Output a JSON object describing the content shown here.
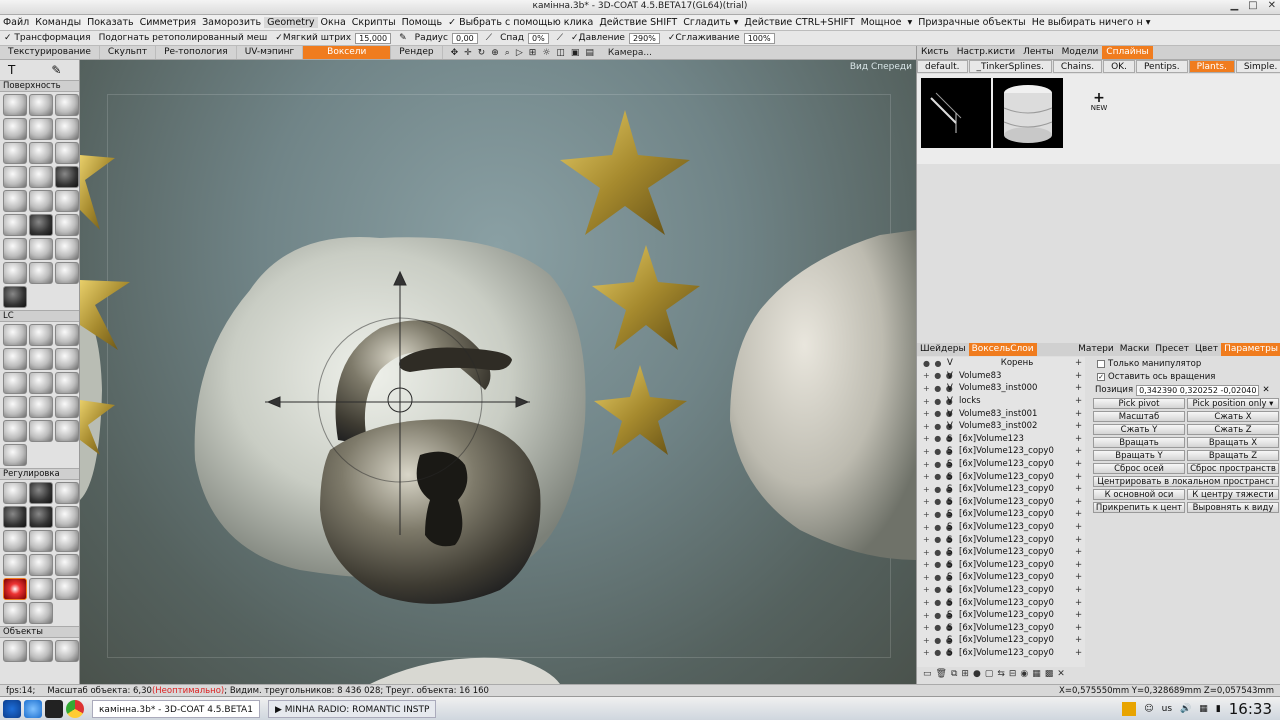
{
  "window": {
    "title": "камінна.3b* - 3D-COAT 4.5.BETA17(GL64)(trial)"
  },
  "menu": [
    "Файл",
    "Команды",
    "Показать",
    "Симметрия",
    "Заморозить",
    "Geometry",
    "Окна",
    "Скрипты",
    "Помощь",
    "✓ Выбрать с помощью клика",
    "Действие SHIFT",
    "Сгладить ▾",
    "Действие CTRL+SHIFT",
    "Мощное",
    "▾",
    "Призрачные объекты",
    "Не выбирать ничего н ▾"
  ],
  "options": {
    "transform": "✓ Трансформация",
    "retopo": "Подогнать ретополированный меш",
    "soft_stroke_label": "✓Мягкий штрих",
    "soft_stroke_value": "15,000",
    "radius_label": "Радиус",
    "radius_value": "0,00",
    "falloff_label": "Спад",
    "falloff_value": "0%",
    "pressure_label": "✓Давление",
    "pressure_value": "290%",
    "smoothing_label": "✓Сглаживание",
    "smoothing_value": "100%"
  },
  "rooms": {
    "tabs": [
      "Текстурирование",
      "Скульпт",
      "Ре-топология",
      "UV-мэпинг",
      "Воксели",
      "Рендер"
    ],
    "active": "Воксели",
    "camera": "Камера..."
  },
  "left": {
    "sections": [
      "Поверхность",
      "LC",
      "Регулировка",
      "Объекты"
    ]
  },
  "viewport": {
    "view_label": "Вид Спереди"
  },
  "right": {
    "tabs": [
      "Кисть",
      "Настр.кисти",
      "Ленты",
      "Модели",
      "Сплайны"
    ],
    "active_tab": "Сплайны",
    "presets": [
      "default.",
      "_TinkerSplines.",
      "Chains.",
      "OK.",
      "Pentips.",
      "Plants.",
      "Simple."
    ],
    "active_preset": "Plants.",
    "new_label": "NEW",
    "lower_left_tabs": [
      "Шейдеры",
      "ВоксельСлои"
    ],
    "lower_left_active": "ВоксельСлои",
    "lower_right_tabs": [
      "Матери",
      "Маски",
      "Пресет",
      "Цвет",
      "Параметры"
    ],
    "lower_right_active": "Параметры",
    "root_label": "Корень",
    "layers": [
      {
        "kind": "V",
        "name": "Volume83"
      },
      {
        "kind": "V",
        "name": "Volume83_inst000"
      },
      {
        "kind": "V",
        "name": "locks"
      },
      {
        "kind": "V",
        "name": "Volume83_inst001"
      },
      {
        "kind": "V",
        "name": "Volume83_inst002"
      },
      {
        "kind": "S",
        "name": "[6x]Volume123"
      },
      {
        "kind": "S",
        "name": "[6x]Volume123_copy0"
      },
      {
        "kind": "S",
        "name": "[6x]Volume123_copy0"
      },
      {
        "kind": "S",
        "name": "[6x]Volume123_copy0"
      },
      {
        "kind": "S",
        "name": "[6x]Volume123_copy0"
      },
      {
        "kind": "S",
        "name": "[6x]Volume123_copy0"
      },
      {
        "kind": "S",
        "name": "[6x]Volume123_copy0"
      },
      {
        "kind": "S",
        "name": "[6x]Volume123_copy0"
      },
      {
        "kind": "S",
        "name": "[6x]Volume123_copy0"
      },
      {
        "kind": "S",
        "name": "[6x]Volume123_copy0"
      },
      {
        "kind": "S",
        "name": "[6x]Volume123_copy0"
      },
      {
        "kind": "S",
        "name": "[6x]Volume123_copy0"
      },
      {
        "kind": "S",
        "name": "[6x]Volume123_copy0"
      },
      {
        "kind": "S",
        "name": "[6x]Volume123_copy0"
      },
      {
        "kind": "S",
        "name": "[6x]Volume123_copy0"
      },
      {
        "kind": "S",
        "name": "[6x]Volume123_copy0"
      },
      {
        "kind": "S",
        "name": "[6x]Volume123_copy0"
      },
      {
        "kind": "S",
        "name": "[6x]Volume123_copy0"
      }
    ],
    "props": {
      "only_manip": "Только манипулятор",
      "keep_axis": "Оставить ось вращения",
      "position_label": "Позиция",
      "position_value": "0,342390 0,320252 -0,02040",
      "pick_pivot": "Pick pivot",
      "pick_position": "Pick position only ▾",
      "scale": "Масштаб",
      "squeeze_x": "Сжать X",
      "squeeze_y": "Сжать Y",
      "squeeze_z": "Сжать Z",
      "rotate": "Вращать",
      "rotate_x": "Вращать X",
      "rotate_y": "Вращать Y",
      "rotate_z": "Вращать Z",
      "reset_axes": "Сброс осей",
      "reset_space": "Сброс пространств",
      "center_local": "Центрировать в локальном пространст",
      "to_main_axis": "К основной оси",
      "to_gravity": "К центру тяжести",
      "attach_center": "Прикрепить к цент",
      "align_view": "Выровнять к виду"
    }
  },
  "status": {
    "fps": "fps:14;",
    "scale": "Масштаб объекта: 6,30",
    "warn": "(Неоптимально)",
    "visible": "; Видим. треугольников: 8 436 028; Треуг. объекта: 16 160",
    "coords": "X=0,575550mm  Y=0,328689mm  Z=0,057543mm"
  },
  "taskbar": {
    "task1": "камінна.3b* - 3D-COAT 4.5.BETA1",
    "task2": "▶ MINHA RADIO: ROMANTIC INSTP",
    "lang": "us",
    "time": "16:33"
  }
}
